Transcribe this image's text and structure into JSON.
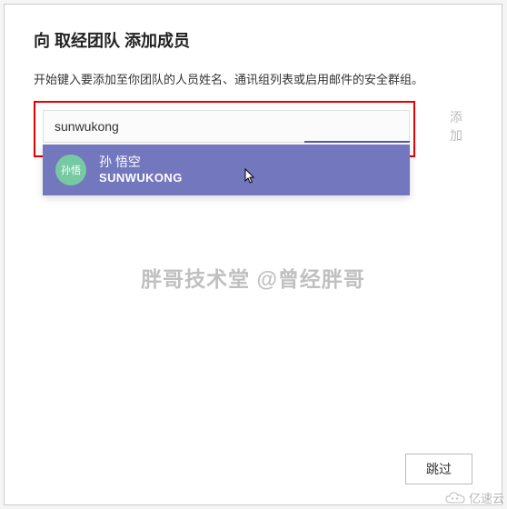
{
  "dialog": {
    "title_prefix": "向 ",
    "title_team": "取经团队",
    "title_suffix": " 添加成员",
    "subtitle": "开始键入要添加至你团队的人员姓名、通讯组列表或启用邮件的安全群组。"
  },
  "search": {
    "value": "sunwukong",
    "placeholder": ""
  },
  "suggestion": {
    "avatar_initials": "孙悟",
    "name": "孙 悟空",
    "id": "SUNWUKONG"
  },
  "buttons": {
    "add": "添加",
    "skip": "跳过"
  },
  "watermark": {
    "center": "胖哥技术堂  @曾经胖哥",
    "corner": "亿速云"
  },
  "colors": {
    "highlight": "#e60000",
    "accent": "#7377bd",
    "avatar": "#76c9a2"
  }
}
